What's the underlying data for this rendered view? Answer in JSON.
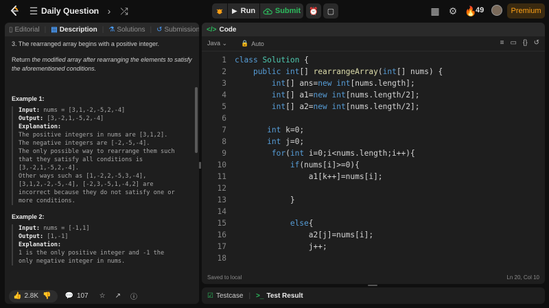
{
  "topbar": {
    "title": "Daily Question",
    "run_label": "Run",
    "submit_label": "Submit",
    "streak_count": "49",
    "premium_label": "Premium"
  },
  "left_tabs": [
    {
      "label": "Editorial",
      "icon": "book-icon"
    },
    {
      "label": "Description",
      "icon": "document-icon"
    },
    {
      "label": "Solutions",
      "icon": "flask-icon"
    },
    {
      "label": "Submissions",
      "icon": "history-icon"
    }
  ],
  "description": {
    "line1": "3. The rearranged array begins with a positive integer.",
    "return_pre": "Return ",
    "return_italic": "the modified array after rearranging the elements to satisfy the aforementioned conditions.",
    "return_line2": "satisfy the aforementioned conditions."
  },
  "examples": [
    {
      "title": "Example 1:",
      "input_label": "Input:",
      "input_value": "nums = [3,1,-2,-5,2,-4]",
      "output_label": "Output:",
      "output_value": "[3,-2,1,-5,2,-4]",
      "explanation_label": "Explanation:",
      "explanation_lines": [
        "The positive integers in nums are [3,1,2].",
        "The negative integers are [-2,-5,-4].",
        "The only possible way to rearrange them such",
        "that they satisfy all conditions is",
        "[3,-2,1,-5,2,-4].",
        "Other ways such as [1,-2,2,-5,3,-4],",
        "[3,1,2,-2,-5,-4], [-2,3,-5,1,-4,2] are",
        "incorrect because they do not satisfy one or",
        "more conditions."
      ]
    },
    {
      "title": "Example 2:",
      "input_label": "Input:",
      "input_value": "nums = [-1,1]",
      "output_label": "Output:",
      "output_value": "[1,-1]",
      "explanation_label": "Explanation:",
      "explanation_lines": [
        "1 is the only positive integer and -1 the",
        "only negative integer in nums."
      ]
    }
  ],
  "left_bottom": {
    "likes": "2.8K",
    "comments": "107"
  },
  "code_panel": {
    "title": "Code",
    "language": "Java",
    "mode": "Auto",
    "status_left": "Saved to local",
    "status_right": "Ln 20, Col 10"
  },
  "bottom_tabs": {
    "testcase": "Testcase",
    "test_result": "Test Result"
  },
  "colors": {
    "accent_green": "#2cbb5d",
    "premium_orange": "#ffa116",
    "keyword_blue": "#569cd6",
    "type_teal": "#4ec9b0",
    "function_yellow": "#dcdcaa"
  }
}
